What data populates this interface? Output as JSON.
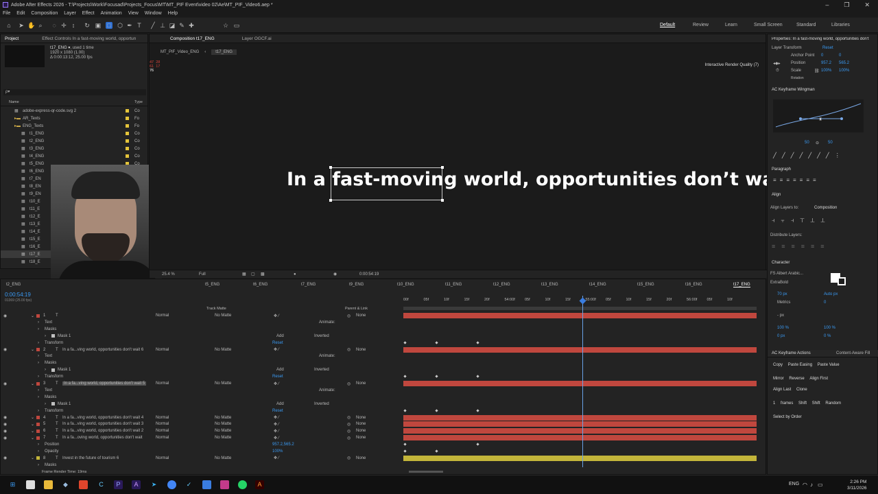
{
  "window": {
    "title": "Adobe After Effects 2026 - T:\\Projects\\Work\\Focusad\\Projects_Focus\\MT\\MT_PIF Event\\video 02\\Ae\\MT_PIF_Video6.aep *"
  },
  "menu": [
    "File",
    "Edit",
    "Composition",
    "Layer",
    "Effect",
    "Animation",
    "View",
    "Window",
    "Help"
  ],
  "workspaces": [
    "Default",
    "Review",
    "Learn",
    "Small Screen",
    "Standard",
    "Libraries"
  ],
  "project": {
    "tab": "Project",
    "effect_tab": "Effect Controls In a fast-moving world, opportun",
    "item_name": "t17_ENG ▾",
    "item_used": ", used 1 time",
    "item_dims": "1920 x 1080 (1.00)",
    "item_dur": "Δ 0:00:13:12, 25.00 fps",
    "search_placeholder": "ρ▾",
    "col_name": "Name",
    "col_type": "Type",
    "items": [
      {
        "name": "adobe-express-qr-code.svg 2",
        "type": "Co"
      },
      {
        "name": "AR_Texts",
        "type": "Fo"
      },
      {
        "name": "ENG_Texts",
        "type": "Fo"
      },
      {
        "name": "t1_ENG",
        "type": "Co"
      },
      {
        "name": "t2_ENG",
        "type": "Co"
      },
      {
        "name": "t3_ENG",
        "type": "Co"
      },
      {
        "name": "t4_ENG",
        "type": "Co"
      },
      {
        "name": "t5_ENG",
        "type": "Co"
      },
      {
        "name": "t6_ENG",
        "type": ""
      },
      {
        "name": "t7_EN",
        "type": ""
      },
      {
        "name": "t8_EN",
        "type": ""
      },
      {
        "name": "t9_EN",
        "type": ""
      },
      {
        "name": "t10_E",
        "type": ""
      },
      {
        "name": "t11_E",
        "type": ""
      },
      {
        "name": "t12_E",
        "type": ""
      },
      {
        "name": "t13_E",
        "type": ""
      },
      {
        "name": "t14_E",
        "type": ""
      },
      {
        "name": "t15_E",
        "type": ""
      },
      {
        "name": "t16_E",
        "type": ""
      },
      {
        "name": "t17_E",
        "type": ""
      },
      {
        "name": "t18_E",
        "type": ""
      }
    ]
  },
  "comp": {
    "tab": "Composition t17_ENG",
    "layer_tab": "Layer OGCF.ai",
    "crumb1": "MT_PIF_Video_ENG",
    "crumb2": "t17_ENG",
    "render_quality": "Interactive Render Quality (7)",
    "canvas_text": "In a fast-moving world, opportunities don’t wait",
    "zoom": "25.4 %",
    "res": "Full",
    "timecode": "0:00:54:19",
    "hud": [
      "47",
      "28",
      "61",
      "17",
      "76"
    ]
  },
  "timeline": {
    "timecode": "0:00:54:19",
    "fps": "01369 (25.00 fps)",
    "tabs": [
      "t2_ENG",
      "t5_ENG",
      "t6_ENG",
      "t7_ENG",
      "t9_ENG",
      "t10_ENG",
      "t11_ENG",
      "t12_ENG",
      "t13_ENG",
      "t14_ENG",
      "t15_ENG",
      "t16_ENG",
      "t17_ENG"
    ],
    "ruler": [
      "00f",
      "05f",
      "10f",
      "15f",
      "20f",
      "54:00f",
      "05f",
      "10f",
      "15f",
      "55:00f",
      "05f",
      "10f",
      "15f",
      "20f",
      "56:00f",
      "05f",
      "10f"
    ],
    "col_trackmatte": "Track Matte",
    "col_parent": "Parent & Link",
    "rows": [
      {
        "num": "1",
        "name": "",
        "mode": "Normal",
        "matte": "No Matte",
        "parent": "None",
        "kind": "layer",
        "color": "#c0473e"
      },
      {
        "num": "",
        "name": "Text",
        "kind": "prop",
        "extra": "Animate:"
      },
      {
        "num": "",
        "name": "Masks",
        "kind": "prop"
      },
      {
        "num": "",
        "name": "Mask 1",
        "kind": "mask",
        "add": "Add",
        "inv": "Inverted"
      },
      {
        "num": "",
        "name": "Transform",
        "kind": "prop",
        "reset": "Reset"
      },
      {
        "num": "2",
        "name": "In a fa...ving world, opportunities don't wait 6",
        "mode": "Normal",
        "matte": "No Matte",
        "parent": "None",
        "kind": "layer",
        "color": "#c0473e"
      },
      {
        "num": "",
        "name": "Text",
        "kind": "prop",
        "extra": "Animate:"
      },
      {
        "num": "",
        "name": "Masks",
        "kind": "prop"
      },
      {
        "num": "",
        "name": "Mask 1",
        "kind": "mask",
        "add": "Add",
        "inv": "Inverted"
      },
      {
        "num": "",
        "name": "Transform",
        "kind": "prop",
        "reset": "Reset"
      },
      {
        "num": "3",
        "name": "In a fa...ving world, opportunities don't wait 5",
        "mode": "Normal",
        "matte": "No Matte",
        "parent": "None",
        "kind": "layer",
        "color": "#c0473e",
        "selected": true
      },
      {
        "num": "",
        "name": "Text",
        "kind": "prop",
        "extra": "Animate:"
      },
      {
        "num": "",
        "name": "Masks",
        "kind": "prop"
      },
      {
        "num": "",
        "name": "Mask 1",
        "kind": "mask",
        "add": "Add",
        "inv": "Inverted"
      },
      {
        "num": "",
        "name": "Transform",
        "kind": "prop",
        "reset": "Reset"
      },
      {
        "num": "4",
        "name": "In a fa...ving world, opportunities don't wait 4",
        "mode": "Normal",
        "matte": "No Matte",
        "parent": "None",
        "kind": "layer",
        "color": "#c0473e"
      },
      {
        "num": "5",
        "name": "In a fa...ving world, opportunities don't wait 3",
        "mode": "Normal",
        "matte": "No Matte",
        "parent": "None",
        "kind": "layer",
        "color": "#c0473e"
      },
      {
        "num": "6",
        "name": "In a fa...ving world, opportunities don't wait 2",
        "mode": "Normal",
        "matte": "No Matte",
        "parent": "None",
        "kind": "layer",
        "color": "#c0473e"
      },
      {
        "num": "7",
        "name": "In a fa...oving world, opportunities don't wait",
        "mode": "Normal",
        "matte": "No Matte",
        "parent": "None",
        "kind": "layer",
        "color": "#c0473e"
      },
      {
        "num": "",
        "name": "Position",
        "kind": "prop",
        "val": "957.2,565.2"
      },
      {
        "num": "",
        "name": "Opacity",
        "kind": "prop",
        "val": "100%"
      },
      {
        "num": "8",
        "name": "Invest in the future of tourism 6",
        "mode": "Normal",
        "matte": "No Matte",
        "parent": "None",
        "kind": "layer",
        "color": "#c3b53a"
      },
      {
        "num": "",
        "name": "Masks",
        "kind": "prop"
      }
    ],
    "render_time": "Frame Render Time: 19ms"
  },
  "properties": {
    "title": "Properties: In a fast-moving world, opportunities don't",
    "section": "Layer Transform",
    "reset": "Reset",
    "anchor_label": "Anchor Point",
    "anchor_x": "0",
    "anchor_y": "0",
    "position_label": "Position",
    "pos_x": "957.2",
    "pos_y": "565.2",
    "scale_label": "Scale",
    "scale_x": "100%",
    "scale_y": "100%",
    "rotation_label": "Rotation"
  },
  "wingman": {
    "title": "AC Keyframe Wingman",
    "val1": "50",
    "val2": "50"
  },
  "paragraph": {
    "title": "Paragraph"
  },
  "align": {
    "title": "Align",
    "align_to_label": "Align Layers to:",
    "align_to_value": "Composition",
    "distribute": "Distribute Layers:"
  },
  "character": {
    "title": "Character",
    "font": "FS Albert Arabic...",
    "style": "ExtraBold",
    "size": "70 px",
    "leading": "Auto px",
    "tracking": "Metrics",
    "kerning": "0",
    "vscale": "100 %",
    "hscale": "100 %",
    "baseline": "0 px",
    "tsume": "0 %",
    "unit": "- px"
  },
  "keyframe_actions": {
    "title": "AC Keyframe Actions",
    "fill_tab": "Content-Aware Fill",
    "row1": [
      "Copy",
      "Paste Easing",
      "Paste Value"
    ],
    "row2": [
      "Mirror",
      "Reverse",
      "Align First"
    ],
    "row3": [
      "Align Last",
      "Clone"
    ],
    "row4": [
      "1",
      "frames",
      "Shift",
      "Shift",
      "Random"
    ],
    "select": "Select by Order"
  },
  "taskbar": {
    "lang": "ENG",
    "time": "2:26 PM",
    "date": "3/11/2026"
  }
}
